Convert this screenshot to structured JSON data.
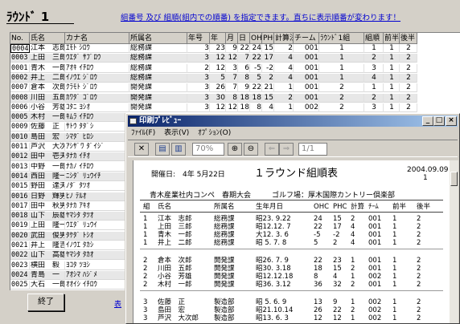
{
  "title": "ﾗｳﾝﾄﾞ 1",
  "notice": "組番号 及び 組順(組内での順番) を指定できます。直ちに表示順番が変わります！",
  "grid": {
    "columns": [
      "No.",
      "氏名",
      "カナ名",
      "所属名",
      "年号",
      "年",
      "月",
      "日",
      "OHC",
      "PHC",
      "計算法",
      "チーム",
      "ﾗｳﾝﾄﾞ1組",
      "組順",
      "前半",
      "後半"
    ],
    "rows": [
      [
        "0004",
        "江本　志郎",
        "ｴﾓﾄ ｼﾛｳ",
        "総務課",
        "3",
        "23",
        "9",
        "22",
        "24",
        "15",
        "2",
        "001",
        "1",
        "1",
        "1",
        "2"
      ],
      [
        "0003",
        "上田　三郎",
        "ｳｴﾀﾞ ｻﾌﾞﾛｳ",
        "総務課",
        "3",
        "12",
        "12",
        "7",
        "22",
        "17",
        "4",
        "001",
        "1",
        "2",
        "1",
        "2"
      ],
      [
        "0001",
        "青木　一郎",
        "ｱｵｷ ｲﾁﾛｳ",
        "総務課",
        "2",
        "12",
        "3",
        "6",
        "-5",
        "-2",
        "4",
        "001",
        "1",
        "3",
        "1",
        "2"
      ],
      [
        "0002",
        "井上　二郎",
        "ｲﾉｳｴ ｼﾞﾛｳ",
        "総務課",
        "3",
        "5",
        "7",
        "8",
        "5",
        "2",
        "4",
        "001",
        "1",
        "4",
        "1",
        "2"
      ],
      [
        "0007",
        "倉本　次郎",
        "ｸﾗﾓﾄ ｼﾞﾛｳ",
        "開発課",
        "3",
        "26",
        "7",
        "9",
        "22",
        "21",
        "1",
        "001",
        "2",
        "1",
        "1",
        "2"
      ],
      [
        "0008",
        "川田　五郎",
        "ｶﾜﾀﾞ ｺﾞﾛｳ",
        "開発課",
        "3",
        "30",
        "8",
        "18",
        "18",
        "15",
        "2",
        "001",
        "2",
        "2",
        "1",
        "2"
      ],
      [
        "0006",
        "小谷　芳雄",
        "ｺﾀﾆ ﾖｼｵ",
        "開発課",
        "3",
        "12",
        "12",
        "18",
        "8",
        "4",
        "1",
        "002",
        "2",
        "3",
        "1",
        "2"
      ],
      [
        "0005",
        "木村　一郎",
        "ｷﾑﾗ ｲﾁﾛｳ",
        "",
        "",
        "",
        "",
        "",
        "",
        "",
        "",
        "",
        "",
        "",
        "",
        ""
      ],
      [
        "0009",
        "佐藤　正",
        "ｻﾄｳ ﾀﾀﾞｼ",
        "",
        "",
        "",
        "",
        "",
        "",
        "",
        "",
        "",
        "",
        "",
        "",
        ""
      ],
      [
        "0010",
        "島田　宏",
        "ｼﾏﾀﾞ ﾋﾛｼ",
        "",
        "",
        "",
        "",
        "",
        "",
        "",
        "",
        "",
        "",
        "",
        "",
        ""
      ],
      [
        "0011",
        "芦沢　大次郎",
        "ｱｼｻﾞﾜ ﾀﾞｲｼﾞ",
        "",
        "",
        "",
        "",
        "",
        "",
        "",
        "",
        "",
        "",
        "",
        "",
        ""
      ],
      [
        "0012",
        "田中　壱夫",
        "ﾀﾅｶ ｲﾁｵ",
        "",
        "",
        "",
        "",
        "",
        "",
        "",
        "",
        "",
        "",
        "",
        "",
        ""
      ],
      [
        "0013",
        "中野　一郎",
        "ﾅｶﾉ ｲﾁﾛｳ",
        "",
        "",
        "",
        "",
        "",
        "",
        "",
        "",
        "",
        "",
        "",
        "",
        ""
      ],
      [
        "0014",
        "西田　隆一",
        "ﾆｼﾀﾞ ﾘｭｳｲﾁ",
        "",
        "",
        "",
        "",
        "",
        "",
        "",
        "",
        "",
        "",
        "",
        "",
        ""
      ],
      [
        "0015",
        "野田　達夫",
        "ﾉﾀﾞ ﾀﾂｵ",
        "",
        "",
        "",
        "",
        "",
        "",
        "",
        "",
        "",
        "",
        "",
        "",
        ""
      ],
      [
        "0016",
        "日野　輝男",
        "ﾋﾉ ﾃﾙｵ",
        "",
        "",
        "",
        "",
        "",
        "",
        "",
        "",
        "",
        "",
        "",
        "",
        ""
      ],
      [
        "0017",
        "田中　秋男",
        "ﾀﾅｶ ｱｷｵ",
        "",
        "",
        "",
        "",
        "",
        "",
        "",
        "",
        "",
        "",
        "",
        "",
        ""
      ],
      [
        "0018",
        "山下　辰雄",
        "ﾔﾏｼﾀ ﾀﾂｵ",
        "",
        "",
        "",
        "",
        "",
        "",
        "",
        "",
        "",
        "",
        "",
        "",
        ""
      ],
      [
        "0019",
        "上田　隆一朗",
        "ｳｴﾀﾞ ﾘｭｳｲ",
        "",
        "",
        "",
        "",
        "",
        "",
        "",
        "",
        "",
        "",
        "",
        "",
        ""
      ],
      [
        "0020",
        "武田　俊男",
        "ﾀｹﾀﾞ ﾄｼｵ",
        "",
        "",
        "",
        "",
        "",
        "",
        "",
        "",
        "",
        "",
        "",
        "",
        ""
      ],
      [
        "0021",
        "井上　隆吉",
        "ｲﾉｳｴ ﾀｶｼ",
        "",
        "",
        "",
        "",
        "",
        "",
        "",
        "",
        "",
        "",
        "",
        "",
        ""
      ],
      [
        "0022",
        "山下　高雄",
        "ﾔﾏｼﾀ ﾀｶｵ",
        "",
        "",
        "",
        "",
        "",
        "",
        "",
        "",
        "",
        "",
        "",
        "",
        ""
      ],
      [
        "0023",
        "横田　毅",
        "ﾖｺﾀ ﾂﾖｼ",
        "",
        "",
        "",
        "",
        "",
        "",
        "",
        "",
        "",
        "",
        "",
        "",
        ""
      ],
      [
        "0024",
        "青島　一",
        "ｱｵｼﾏ ﾊｼﾞﾒ",
        "",
        "",
        "",
        "",
        "",
        "",
        "",
        "",
        "",
        "",
        "",
        "",
        ""
      ],
      [
        "0025",
        "大石　一郎",
        "ｵｵｲｼ ｲﾁﾛｳ",
        "",
        "",
        "",
        "",
        "",
        "",
        "",
        "",
        "",
        "",
        "",
        "",
        ""
      ]
    ]
  },
  "end_button": "終了",
  "hint": "表",
  "preview": {
    "window_title": "印刷ﾌﾟﾚﾋﾞｭｰ",
    "menu": [
      "ﾌｧｲﾙ(F)",
      "表示(V)",
      "ｵﾌﾟｼｮﾝ(O)"
    ],
    "zoom": "70%",
    "page_field": "1/1",
    "report": {
      "date_label": "開催日:　4年 5月22日",
      "heading": "１ラウンド組順表",
      "print_date": "2004.09.09",
      "page_no": "1",
      "event": "青木産業社内コンペ　春期大会",
      "course": "ゴルフ場：厚木国際カントリー倶楽部",
      "columns": [
        "組",
        "氏名",
        "所属名",
        "生年月日",
        "OHC",
        "PHC",
        "計算",
        "ﾁｰﾑ",
        "前半",
        "後半"
      ],
      "groups": [
        [
          [
            "1",
            "江本　志郎",
            "総務課",
            "昭23. 9.22",
            "24",
            "15",
            "2",
            "001",
            "1",
            "2"
          ],
          [
            "1",
            "上田　三郎",
            "総務課",
            "昭12.12. 7",
            "22",
            "17",
            "4",
            "001",
            "1",
            "2"
          ],
          [
            "1",
            "青木　一郎",
            "総務課",
            "大12. 3. 6",
            "-5",
            "-2",
            "4",
            "001",
            "1",
            "2"
          ],
          [
            "1",
            "井上　二郎",
            "総務課",
            "昭 5. 7. 8",
            "5",
            "2",
            "4",
            "001",
            "1",
            "2"
          ]
        ],
        [
          [
            "2",
            "倉本　次郎",
            "開発課",
            "昭26. 7. 9",
            "22",
            "23",
            "1",
            "001",
            "1",
            "2"
          ],
          [
            "2",
            "川田　五郎",
            "開発課",
            "昭30. 3.18",
            "18",
            "15",
            "2",
            "001",
            "1",
            "2"
          ],
          [
            "2",
            "小谷　芳雄",
            "開発課",
            "昭12.12.18",
            "8",
            "4",
            "1",
            "002",
            "1",
            "2"
          ],
          [
            "2",
            "木村　一郎",
            "開発課",
            "昭36. 3.12",
            "36",
            "32",
            "2",
            "001",
            "1",
            "2"
          ]
        ],
        [
          [
            "3",
            "佐藤　正",
            "製造部",
            "昭 5. 6. 9",
            "13",
            "9",
            "1",
            "002",
            "1",
            "2"
          ],
          [
            "3",
            "島田　宏",
            "製造部",
            "昭21.10.14",
            "26",
            "22",
            "2",
            "002",
            "1",
            "2"
          ],
          [
            "3",
            "芦沢　大次郎",
            "製造部",
            "昭13. 6. 3",
            "12",
            "12",
            "1",
            "002",
            "1",
            "2"
          ]
        ]
      ]
    }
  }
}
